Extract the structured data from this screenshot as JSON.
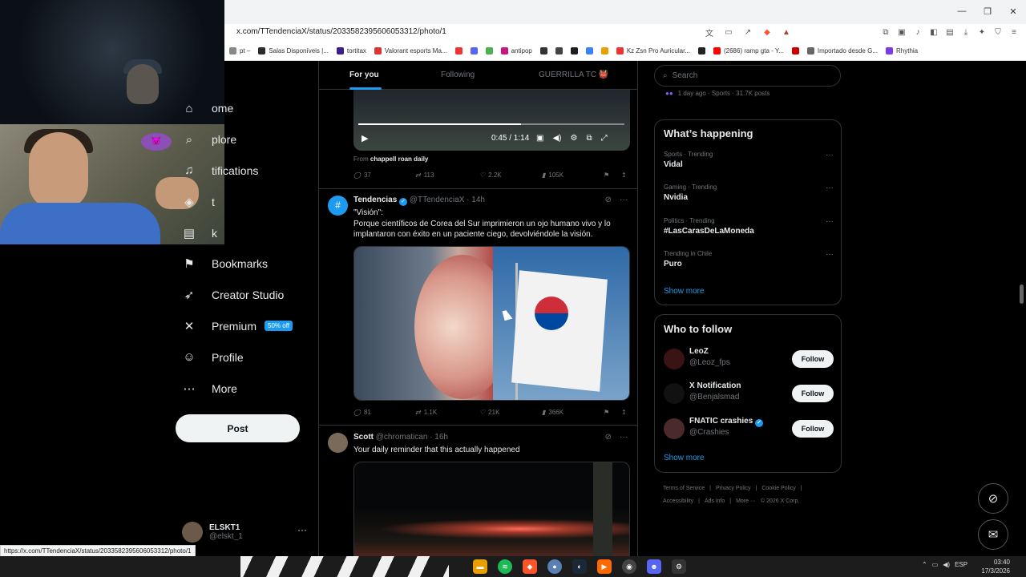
{
  "browser": {
    "url": "x.com/TTendenciaX/status/2033582395606053312/photo/1",
    "status_url": "https://x.com/TTendenciaX/status/2033582395606053312/photo/1",
    "bookmarks": [
      {
        "label": "pt –",
        "color": "#888"
      },
      {
        "label": "Salas Disponíveis |...",
        "color": "#2b2b2b"
      },
      {
        "label": "tortitax",
        "color": "#3a1f8a"
      },
      {
        "label": "Valorant esports Ma...",
        "color": "#d33"
      },
      {
        "label": "",
        "color": "#e33"
      },
      {
        "label": "",
        "color": "#5865f2"
      },
      {
        "label": "",
        "color": "#4caf50"
      },
      {
        "label": "antipop",
        "color": "#c71585"
      },
      {
        "label": "",
        "color": "#333"
      },
      {
        "label": "",
        "color": "#444"
      },
      {
        "label": "",
        "color": "#1d1d1d"
      },
      {
        "label": "",
        "color": "#3b82f6"
      },
      {
        "label": "",
        "color": "#e8a000"
      },
      {
        "label": "Kz Zsn Pro Auricular...",
        "color": "#e33"
      },
      {
        "label": "",
        "color": "#222"
      },
      {
        "label": "(2686) ramp gta - Y...",
        "color": "#f00"
      },
      {
        "label": "",
        "color": "#c00"
      },
      {
        "label": "Importado desde G...",
        "color": "#666"
      },
      {
        "label": "Rhythia",
        "color": "#7c3aed"
      }
    ]
  },
  "nav": {
    "items": [
      {
        "label": "ome",
        "icon": "home-icon",
        "glyph": "⌂"
      },
      {
        "label": "plore",
        "icon": "search-icon",
        "glyph": "⌕"
      },
      {
        "label": "tifications",
        "icon": "bell-icon",
        "glyph": "♫"
      },
      {
        "label": "t",
        "icon": "grok-icon",
        "glyph": "◈"
      },
      {
        "label": "k",
        "icon": "list-icon",
        "glyph": "▤"
      },
      {
        "label": "Bookmarks",
        "icon": "bookmark-icon",
        "glyph": "⚑"
      },
      {
        "label": "Creator Studio",
        "icon": "rocket-icon",
        "glyph": "➶"
      },
      {
        "label": "Premium",
        "icon": "x-logo-icon",
        "glyph": "✕",
        "badge": "50% off"
      },
      {
        "label": "Profile",
        "icon": "person-icon",
        "glyph": "☺"
      },
      {
        "label": "More",
        "icon": "more-circle-icon",
        "glyph": "⋯"
      }
    ],
    "post_label": "Post",
    "account": {
      "name": "ELSKT1",
      "handle": "@elskt_1"
    }
  },
  "feed": {
    "tabs": [
      "For you",
      "Following",
      "GUERRILLA TC 👹"
    ],
    "video": {
      "time": "0:45 / 1:14",
      "progress": 0.61
    },
    "from_prefix": "From",
    "from_source": "chappell roan daily",
    "tweet0_actions": {
      "replies": "37",
      "reposts": "113",
      "likes": "2.2K",
      "views": "105K"
    },
    "tweet1": {
      "name": "Tendencias",
      "handle": "@TTendenciaX",
      "time": "14h",
      "line1": "\"Visión\":",
      "line2": "Porque científicos de Corea del Sur imprimieron un ojo humano vivo y lo implantaron con éxito en un paciente ciego, devolviéndole la visión.",
      "actions": {
        "replies": "81",
        "reposts": "1.1K",
        "likes": "21K",
        "views": "366K"
      }
    },
    "tweet2": {
      "name": "Scott",
      "handle": "@chromatican",
      "time": "16h",
      "text": "Your daily reminder that this actually happened"
    }
  },
  "sidebar": {
    "search_placeholder": "Search",
    "trend_fragment": "1 day ago · Sports · 31.7K posts",
    "whats_happening_title": "What’s happening",
    "trends": [
      {
        "context": "Sports · Trending",
        "name": "Vidal"
      },
      {
        "context": "Gaming · Trending",
        "name": "Nvidia"
      },
      {
        "context": "Politics · Trending",
        "name": "#LasCarasDeLaMoneda"
      },
      {
        "context": "Trending in Chile",
        "name": "Puro"
      }
    ],
    "show_more": "Show more",
    "who_to_follow_title": "Who to follow",
    "follow_label": "Follow",
    "suggestions": [
      {
        "name": "LeoZ",
        "handle": "@Leoz_fps",
        "color": "#3a1414"
      },
      {
        "name": "X Notification",
        "handle": "@Benjalsmad",
        "color": "#111"
      },
      {
        "name": "FNATIC crashies",
        "handle": "@Crashies",
        "color": "#4a2a2a",
        "verified": true
      }
    ],
    "footer": [
      "Terms of Service",
      "|",
      "Privacy Policy",
      "|",
      "Cookie Policy",
      "|",
      "Accessibility",
      "|",
      "Ads info",
      "|",
      "More ···",
      "© 2026 X Corp."
    ]
  },
  "taskbar": {
    "lang": "ESP",
    "time": "03:40",
    "date": "17/3/2026"
  }
}
